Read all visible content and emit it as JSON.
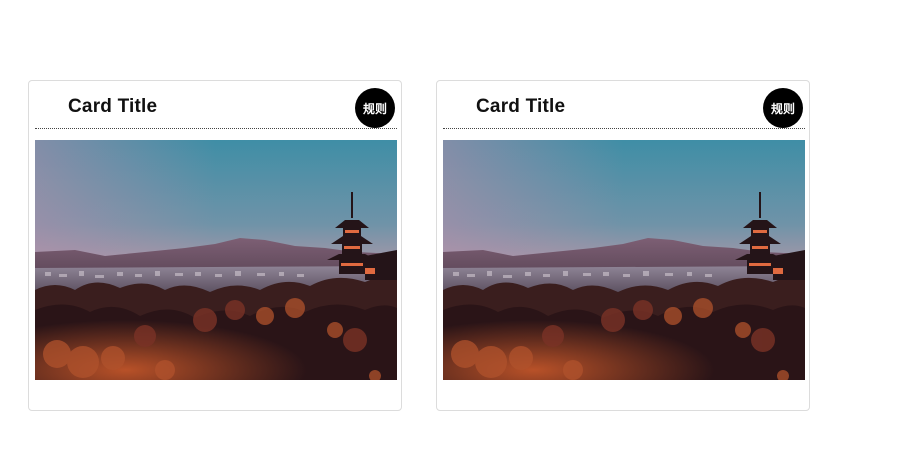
{
  "cards": [
    {
      "title": "Card Title",
      "badge_label": "规则",
      "image_icon": "pagoda-sunset-landscape-image"
    },
    {
      "title": "Card Title",
      "badge_label": "规则",
      "image_icon": "pagoda-sunset-landscape-image"
    }
  ],
  "colors": {
    "badge_bg": "#000000",
    "badge_text": "#ffffff",
    "card_border": "#dcdcdc",
    "title_text": "#111111"
  }
}
